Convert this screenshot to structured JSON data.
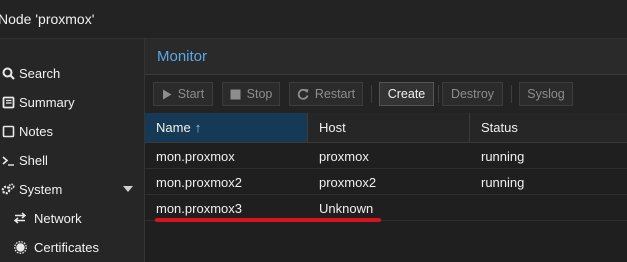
{
  "window": {
    "title": "Node 'proxmox'"
  },
  "sidebar": {
    "items": [
      {
        "label": "Search",
        "icon": "search-icon"
      },
      {
        "label": "Summary",
        "icon": "book-icon"
      },
      {
        "label": "Notes",
        "icon": "notes-icon"
      },
      {
        "label": "Shell",
        "icon": "terminal-icon"
      },
      {
        "label": "System",
        "icon": "cogs-icon",
        "expanded": true
      },
      {
        "label": "Network",
        "icon": "exchange-icon"
      },
      {
        "label": "Certificates",
        "icon": "certificate-icon"
      }
    ]
  },
  "panel": {
    "title": "Monitor"
  },
  "toolbar": {
    "start": "Start",
    "stop": "Stop",
    "restart": "Restart",
    "create": "Create",
    "destroy": "Destroy",
    "syslog": "Syslog"
  },
  "table": {
    "columns": [
      "Name",
      "Host",
      "Status"
    ],
    "sort_column": "Name",
    "sort_direction": "ascending",
    "rows": [
      {
        "name": "mon.proxmox",
        "host": "proxmox",
        "status": "running"
      },
      {
        "name": "mon.proxmox2",
        "host": "proxmox2",
        "status": "running"
      },
      {
        "name": "mon.proxmox3",
        "host": "Unknown",
        "status": ""
      }
    ]
  },
  "colors": {
    "accent": "#5aa8e6",
    "sorted_header": "#163a55",
    "annotation": "#d9121f"
  }
}
